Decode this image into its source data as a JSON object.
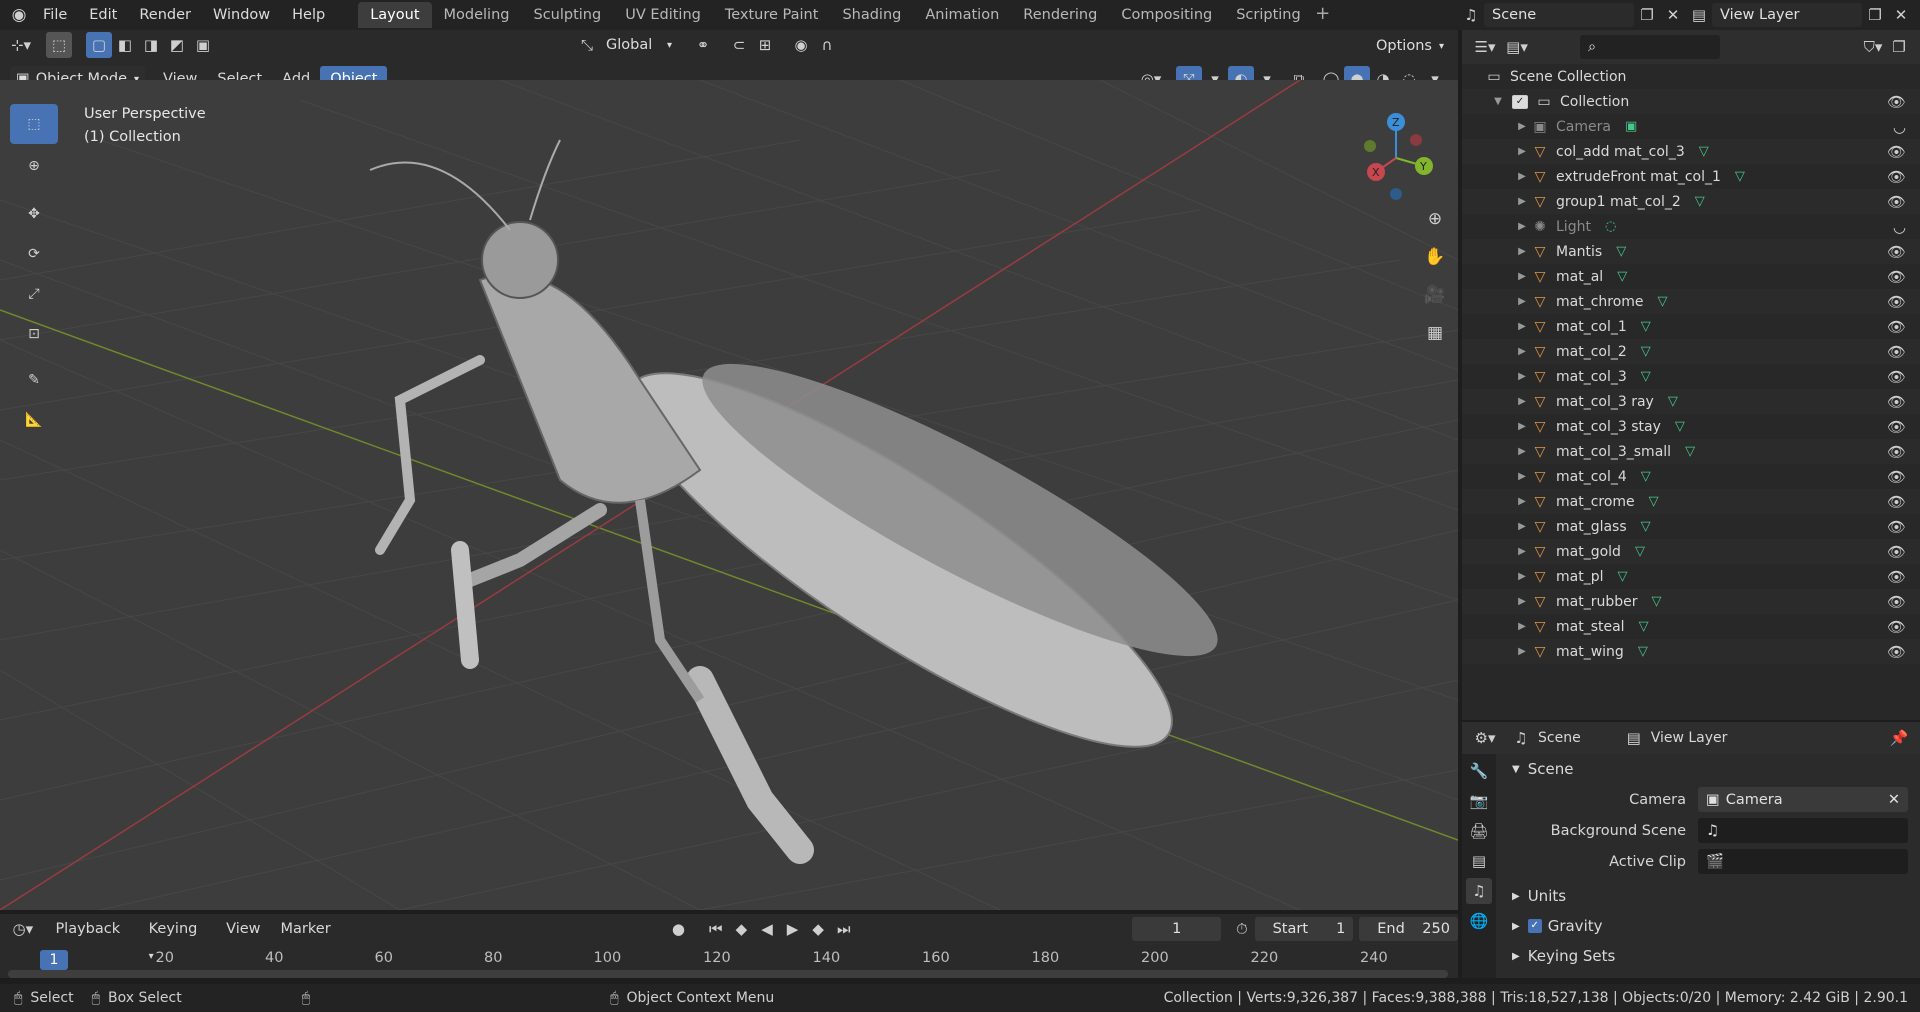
{
  "topbar": {
    "menus": [
      "File",
      "Edit",
      "Render",
      "Window",
      "Help"
    ],
    "workspaces": [
      "Layout",
      "Modeling",
      "Sculpting",
      "UV Editing",
      "Texture Paint",
      "Shading",
      "Animation",
      "Rendering",
      "Compositing",
      "Scripting"
    ],
    "active_workspace": "Layout",
    "scene_name": "Scene",
    "view_layer": "View Layer"
  },
  "tool_header": {
    "transform_orientation": "Global",
    "options_label": "Options"
  },
  "viewport_header": {
    "mode": "Object Mode",
    "menus": [
      "View",
      "Select",
      "Add",
      "Object"
    ],
    "active_menu": "Object"
  },
  "viewport": {
    "perspective_label": "User Perspective",
    "collection_label": "(1) Collection",
    "gizmo": {
      "x": "X",
      "y": "Y",
      "z": "Z"
    }
  },
  "outliner": {
    "root": "Scene Collection",
    "collection": "Collection",
    "items": [
      {
        "name": "Camera",
        "type": "camera",
        "dim": true
      },
      {
        "name": "col_add mat_col_3",
        "type": "mesh"
      },
      {
        "name": "extrudeFront mat_col_1",
        "type": "mesh"
      },
      {
        "name": "group1 mat_col_2",
        "type": "mesh"
      },
      {
        "name": "Light",
        "type": "light",
        "dim": true
      },
      {
        "name": "Mantis",
        "type": "mesh"
      },
      {
        "name": "mat_al",
        "type": "mesh"
      },
      {
        "name": "mat_chrome",
        "type": "mesh"
      },
      {
        "name": "mat_col_1",
        "type": "mesh"
      },
      {
        "name": "mat_col_2",
        "type": "mesh"
      },
      {
        "name": "mat_col_3",
        "type": "mesh"
      },
      {
        "name": "mat_col_3 ray",
        "type": "mesh"
      },
      {
        "name": "mat_col_3 stay",
        "type": "mesh"
      },
      {
        "name": "mat_col_3_small",
        "type": "mesh"
      },
      {
        "name": "mat_col_4",
        "type": "mesh"
      },
      {
        "name": "mat_crome",
        "type": "mesh"
      },
      {
        "name": "mat_glass",
        "type": "mesh"
      },
      {
        "name": "mat_gold",
        "type": "mesh"
      },
      {
        "name": "mat_pl",
        "type": "mesh"
      },
      {
        "name": "mat_rubber",
        "type": "mesh"
      },
      {
        "name": "mat_steal",
        "type": "mesh"
      },
      {
        "name": "mat_wing",
        "type": "mesh"
      }
    ]
  },
  "properties": {
    "tabs": [
      "Scene",
      "View Layer"
    ],
    "section": "Scene",
    "camera_label": "Camera",
    "camera_value": "Camera",
    "background_scene_label": "Background Scene",
    "active_clip_label": "Active Clip",
    "subsections": [
      "Units",
      "Gravity",
      "Keying Sets"
    ],
    "gravity_checked": true
  },
  "timeline": {
    "menus": [
      "Playback",
      "Keying",
      "View",
      "Marker"
    ],
    "current_frame": "1",
    "start_label": "Start",
    "start_value": "1",
    "end_label": "End",
    "end_value": "250",
    "ticks": [
      "1",
      "20",
      "40",
      "60",
      "80",
      "100",
      "120",
      "140",
      "160",
      "180",
      "200",
      "220",
      "240"
    ]
  },
  "statusbar": {
    "select": "Select",
    "box_select": "Box Select",
    "context_menu": "Object Context Menu",
    "stats": "Collection | Verts:9,326,387 | Faces:9,388,388 | Tris:18,527,138 | Objects:0/20 | Memory: 2.42 GiB | 2.90.1"
  },
  "colors": {
    "accent": "#4772b3",
    "mesh_icon": "#44c98a",
    "object_icon": "#e09643",
    "x_axis": "#c8464e",
    "y_axis": "#83b52c",
    "z_axis": "#3b8fd9"
  }
}
